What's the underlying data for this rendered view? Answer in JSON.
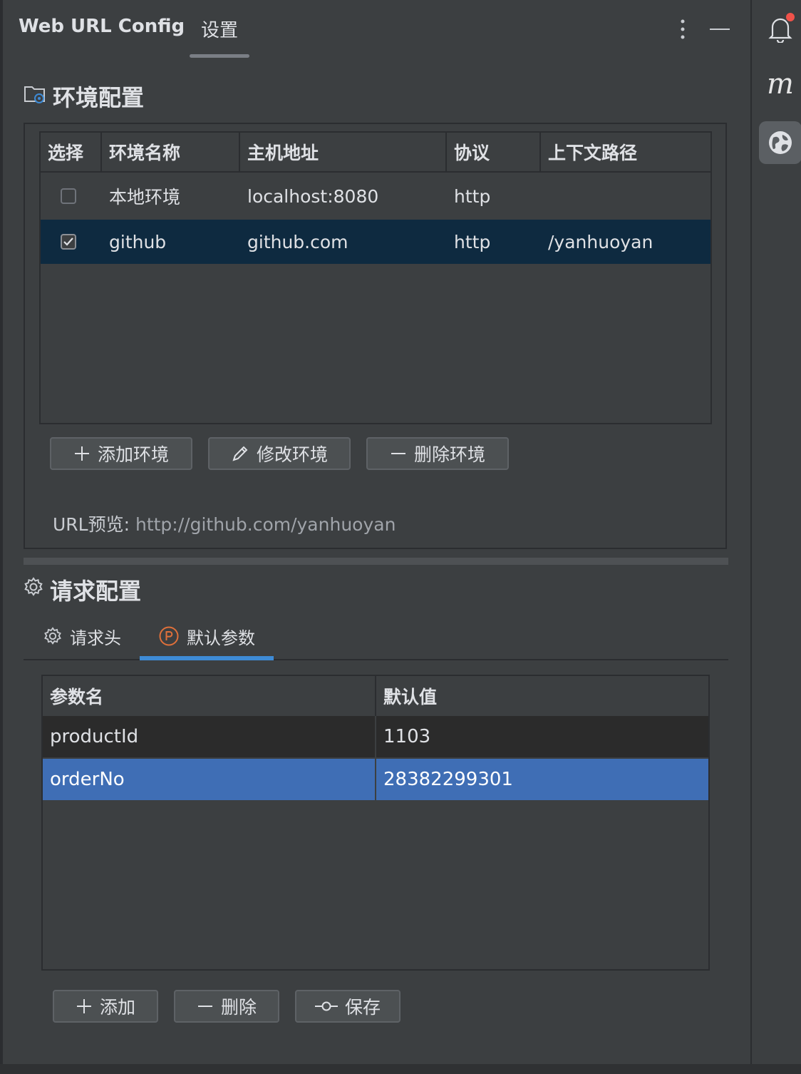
{
  "header": {
    "title": "Web URL Config",
    "tab_settings": "设置"
  },
  "env_section": {
    "title": "环境配置",
    "columns": [
      "选择",
      "环境名称",
      "主机地址",
      "协议",
      "上下文路径"
    ],
    "rows": [
      {
        "checked": false,
        "name": "本地环境",
        "host": "localhost:8080",
        "protocol": "http",
        "context": ""
      },
      {
        "checked": true,
        "name": "github",
        "host": "github.com",
        "protocol": "http",
        "context": "/yanhuoyan"
      }
    ],
    "buttons": {
      "add": "添加环境",
      "edit": "修改环境",
      "delete": "删除环境"
    },
    "url_preview_label": "URL预览:",
    "url_preview_value": "http://github.com/yanhuoyan"
  },
  "request_section": {
    "title": "请求配置",
    "tabs": [
      "请求头",
      "默认参数"
    ],
    "active_tab": "默认参数",
    "columns": [
      "参数名",
      "默认值"
    ],
    "rows": [
      {
        "name": "productId",
        "value": "1103"
      },
      {
        "name": "orderNo",
        "value": "28382299301"
      }
    ],
    "buttons": {
      "add": "添加",
      "delete": "删除",
      "save": "保存"
    }
  },
  "colors": {
    "background": "#3c3f41",
    "selected_row": "#0e2a40",
    "selected_param_row": "#3f6eb5",
    "tab_underline": "#3e8bd6",
    "notification_dot": "#f0524a",
    "param_icon": "#e0703a"
  }
}
